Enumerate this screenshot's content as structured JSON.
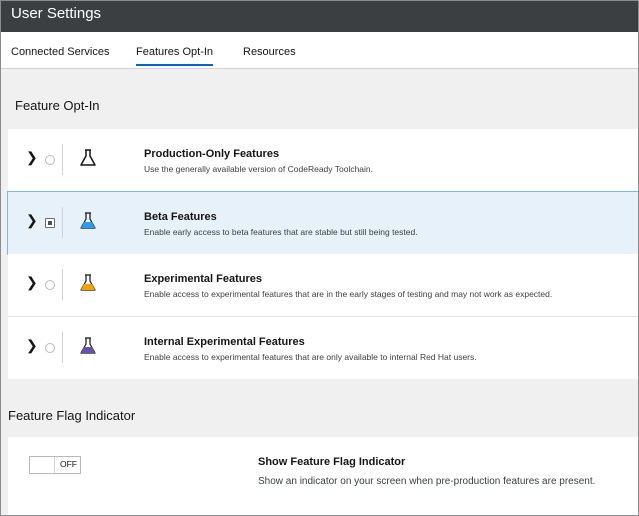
{
  "window": {
    "title": "User Settings"
  },
  "tabs": [
    {
      "label": "Connected Services",
      "active": false
    },
    {
      "label": "Features Opt-In",
      "active": true
    },
    {
      "label": "Resources",
      "active": false
    }
  ],
  "feature_optin": {
    "heading": "Feature Opt-In",
    "options": [
      {
        "title": "Production-Only Features",
        "description": "Use the generally available version of CodeReady Toolchain.",
        "selected": false,
        "icon": "flask-outline-icon",
        "color": "#151515"
      },
      {
        "title": "Beta Features",
        "description": "Enable early access to beta features that are stable but still being tested.",
        "selected": true,
        "icon": "flask-blue-icon",
        "color": "#2b9af3"
      },
      {
        "title": "Experimental Features",
        "description": "Enable access to experimental features that are in the early stages of testing and may not work as expected.",
        "selected": false,
        "icon": "flask-orange-icon",
        "color": "#f4a300"
      },
      {
        "title": "Internal Experimental Features",
        "description": "Enable access to experimental features that are only available to internal Red Hat users.",
        "selected": false,
        "icon": "flask-purple-icon",
        "color": "#6753ac"
      }
    ]
  },
  "feature_flag": {
    "heading": "Feature Flag Indicator",
    "toggle_label": "OFF",
    "toggle_on": false,
    "title": "Show Feature Flag Indicator",
    "description": "Show an indicator on your screen when pre-production features are present."
  },
  "colors": {
    "accent": "#0066cc",
    "titlebar": "#3c3f42",
    "selected_bg": "#e7f1fa"
  }
}
